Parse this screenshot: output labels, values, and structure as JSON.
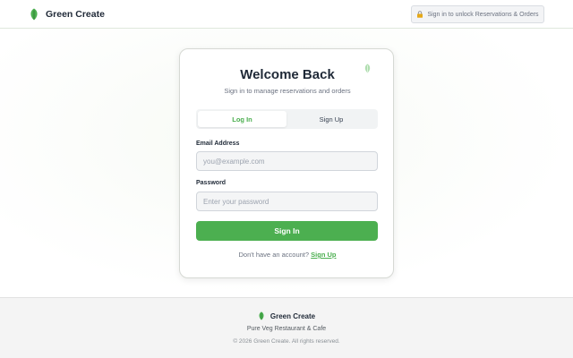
{
  "header": {
    "brand_name": "Green Create",
    "brand_icon": "leaf-icon",
    "unlock_text": "Sign in to unlock Reservations & Orders",
    "unlock_icon": "lock-icon"
  },
  "auth_card": {
    "decor_icon": "leaf-icon",
    "title": "Welcome Back",
    "subtitle": "Sign in to manage reservations and orders",
    "tabs": [
      {
        "label": "Log In",
        "active": true
      },
      {
        "label": "Sign Up",
        "active": false
      }
    ],
    "email": {
      "label": "Email Address",
      "value": "",
      "placeholder": "you@example.com"
    },
    "password": {
      "label": "Password",
      "value": "",
      "placeholder": "Enter your password"
    },
    "submit_label": "Sign In",
    "switch_prompt": "Don't have an account?",
    "switch_link": "Sign Up"
  },
  "footer": {
    "brand_name": "Green Create",
    "tagline": "Pure Veg Restaurant & Cafe",
    "copyright": "© 2026 Green Create. All rights reserved."
  },
  "colors": {
    "accent": "#4caf50",
    "text": "#1f2937",
    "muted": "#6b7280"
  }
}
